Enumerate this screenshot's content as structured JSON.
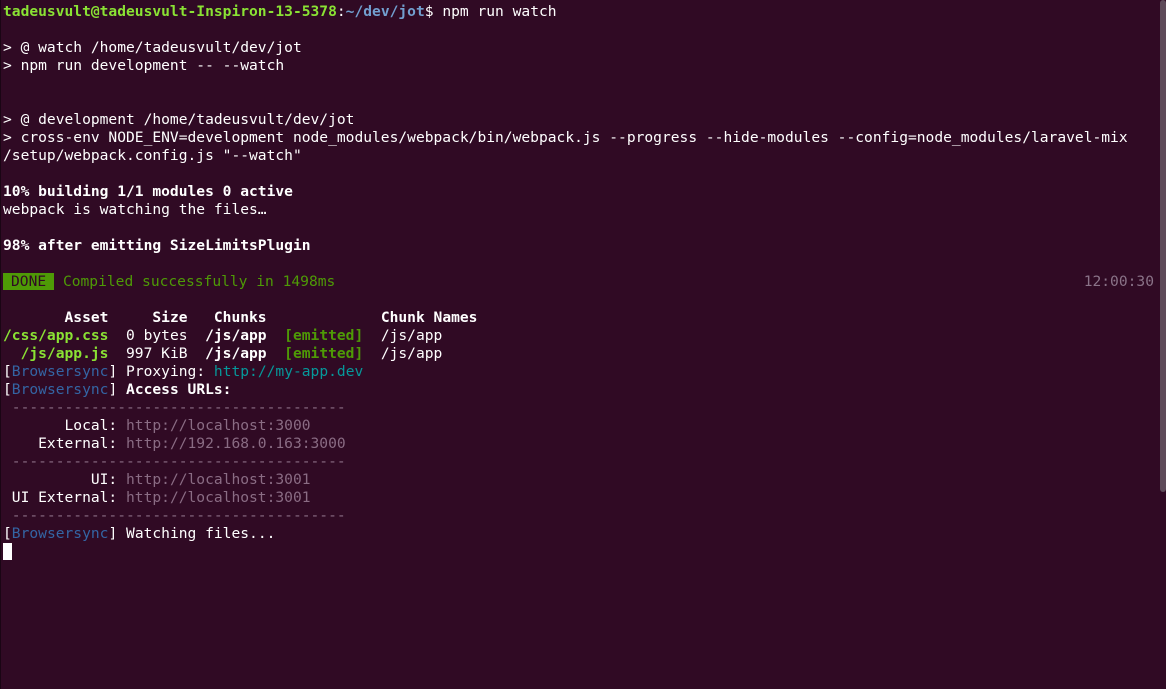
{
  "prompt": {
    "user_host": "tadeusvult@tadeusvult-Inspiron-13-5378",
    "sep": ":",
    "path": "~/dev/jot",
    "dollar": "$",
    "command": " npm run watch"
  },
  "lines": {
    "l1": "> @ watch /home/tadeusvult/dev/jot",
    "l2": "> npm run development -- --watch",
    "l3": "> @ development /home/tadeusvult/dev/jot",
    "l4": "> cross-env NODE_ENV=development node_modules/webpack/bin/webpack.js --progress --hide-modules --config=node_modules/laravel-mix",
    "l5": "/setup/webpack.config.js \"--watch\"",
    "l6": "10% building 1/1 modules 0 active",
    "l7": "webpack is watching the files…",
    "l8": "98% after emitting SizeLimitsPlugin"
  },
  "build": {
    "badge": "DONE",
    "message": "Compiled successfully in 1498ms",
    "time": "12:00:30"
  },
  "table": {
    "headers": {
      "asset": "       Asset",
      "size": "     Size",
      "chunks": "   Chunks",
      "chunk_names": "             Chunk Names"
    },
    "rows": [
      {
        "asset": "/css/app.css",
        "size": "  0 bytes",
        "chunks": "  /js/app",
        "emitted": "[emitted]",
        "name": "  /js/app"
      },
      {
        "asset": "  /js/app.js",
        "size": "  997 KiB",
        "chunks": "  /js/app",
        "emitted": "[emitted]",
        "name": "  /js/app"
      }
    ]
  },
  "browsersync": {
    "open": "[",
    "tag": "Browsersync",
    "close": "]",
    "proxying_label": " Proxying: ",
    "proxying_url": "http://my-app.dev",
    "access_label": " Access URLs:",
    "dashes": " --------------------------------------",
    "local_label": "       Local: ",
    "local_url": "http://localhost:3000",
    "external_label": "    External: ",
    "external_url": "http://192.168.0.163:3000",
    "ui_label": "          UI: ",
    "ui_url": "http://localhost:3001",
    "ui_external_label": " UI External: ",
    "ui_external_url": "http://localhost:3001",
    "watching": " Watching files..."
  }
}
